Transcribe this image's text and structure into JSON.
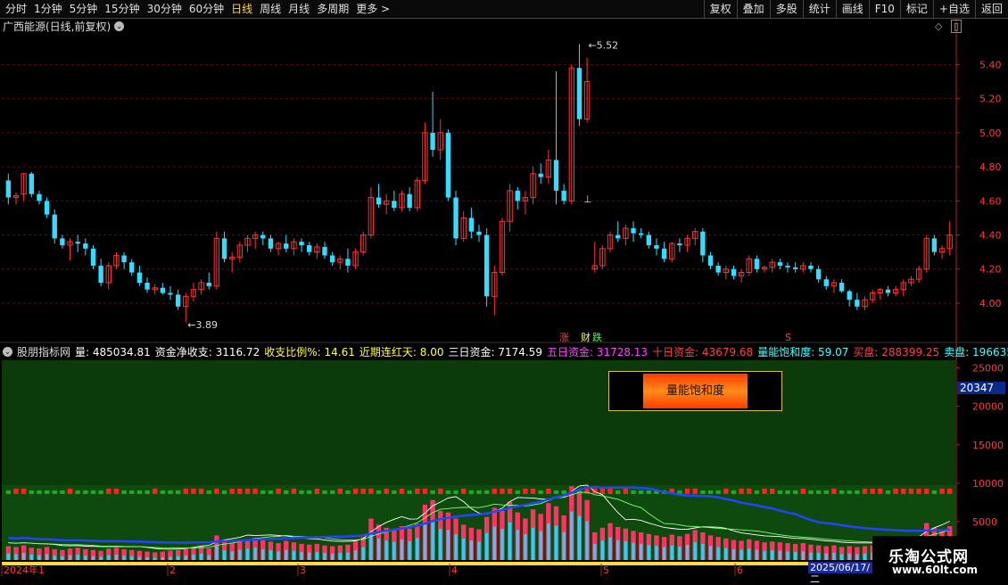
{
  "toolbar": {
    "periods": [
      "分时",
      "1分钟",
      "5分钟",
      "15分钟",
      "30分钟",
      "60分钟",
      "日线",
      "周线",
      "月线",
      "多周期",
      "更多 >"
    ],
    "active_index": 6,
    "right": [
      "复权",
      "叠加",
      "多股",
      "统计",
      "画线",
      "F10",
      "标记",
      "+自选",
      "返回"
    ]
  },
  "main": {
    "title": "广西能源(日线,前复权)",
    "high_label": "5.52",
    "low_label": "3.89",
    "price_ticks": [
      "5.40",
      "5.20",
      "5.00",
      "4.80",
      "4.60",
      "4.40",
      "4.20",
      "4.00"
    ],
    "price_range": [
      3.78,
      5.58
    ],
    "marker_zhang": "涨",
    "marker_cai": "财",
    "marker_die": "跌",
    "marker_s": "S",
    "marker_down": "⊥"
  },
  "indicator": {
    "name": "股朋指标网",
    "fields": [
      {
        "label": "量:",
        "value": "485034.81",
        "color": "#ffffff"
      },
      {
        "label": "资金净收支:",
        "value": "3116.72",
        "color": "#ffffff"
      },
      {
        "label": "收支比例%:",
        "value": "14.61",
        "color": "#ffff44"
      },
      {
        "label": "近期连红天:",
        "value": "8.00",
        "color": "#ffff44"
      },
      {
        "label": "三日资金:",
        "value": "7174.59",
        "color": "#ffffff"
      },
      {
        "label": "五日资金:",
        "value": "31728.13",
        "color": "#ff44ff"
      },
      {
        "label": "十日资金:",
        "value": "43679.68",
        "color": "#ff4040"
      },
      {
        "label": "量能饱和度:",
        "value": "59.07",
        "color": "#44ffff"
      },
      {
        "label": "买盘:",
        "value": "288399.25",
        "color": "#ff4040"
      },
      {
        "label": "卖盘:",
        "value": "196635.",
        "color": "#44ffff"
      }
    ],
    "box_label": "量能饱和度",
    "tag_value": "20347",
    "y_ticks": [
      "25000",
      "20000",
      "15000",
      "10000",
      "5000"
    ],
    "y_range": [
      0,
      26000
    ]
  },
  "x_axis": {
    "labels": [
      "2024年1",
      "2",
      "3",
      "4",
      "5",
      "6"
    ],
    "date_box": "2025/06/17/二"
  },
  "watermark": {
    "title": "乐淘公式网",
    "url": "www.60lt.com"
  },
  "colors": {
    "up": "#ff3333",
    "down": "#33ddff",
    "axis": "#aa2222"
  },
  "chart_data": {
    "type": "candlestick",
    "ohlc": [
      [
        4.72,
        4.76,
        4.58,
        4.62
      ],
      [
        4.62,
        4.65,
        4.58,
        4.63
      ],
      [
        4.64,
        4.76,
        4.6,
        4.76
      ],
      [
        4.76,
        4.77,
        4.62,
        4.64
      ],
      [
        4.64,
        4.66,
        4.58,
        4.6
      ],
      [
        4.6,
        4.62,
        4.5,
        4.52
      ],
      [
        4.52,
        4.55,
        4.35,
        4.38
      ],
      [
        4.38,
        4.4,
        4.32,
        4.34
      ],
      [
        4.34,
        4.38,
        4.25,
        4.36
      ],
      [
        4.36,
        4.4,
        4.3,
        4.35
      ],
      [
        4.35,
        4.38,
        4.28,
        4.32
      ],
      [
        4.32,
        4.34,
        4.2,
        4.22
      ],
      [
        4.22,
        4.26,
        4.1,
        4.12
      ],
      [
        4.12,
        4.24,
        4.08,
        4.22
      ],
      [
        4.22,
        4.3,
        4.2,
        4.28
      ],
      [
        4.28,
        4.3,
        4.2,
        4.24
      ],
      [
        4.24,
        4.26,
        4.16,
        4.18
      ],
      [
        4.18,
        4.22,
        4.1,
        4.12
      ],
      [
        4.12,
        4.15,
        4.06,
        4.08
      ],
      [
        4.08,
        4.11,
        4.05,
        4.09
      ],
      [
        4.09,
        4.12,
        4.05,
        4.06
      ],
      [
        4.06,
        4.1,
        4.02,
        4.05
      ],
      [
        4.05,
        4.08,
        3.96,
        3.98
      ],
      [
        3.98,
        4.06,
        3.89,
        4.04
      ],
      [
        4.04,
        4.12,
        4.01,
        4.08
      ],
      [
        4.08,
        4.14,
        4.05,
        4.12
      ],
      [
        4.12,
        4.18,
        4.08,
        4.1
      ],
      [
        4.1,
        4.42,
        4.08,
        4.38
      ],
      [
        4.38,
        4.42,
        4.24,
        4.26
      ],
      [
        4.26,
        4.3,
        4.18,
        4.27
      ],
      [
        4.27,
        4.36,
        4.24,
        4.34
      ],
      [
        4.34,
        4.4,
        4.3,
        4.38
      ],
      [
        4.38,
        4.42,
        4.32,
        4.4
      ],
      [
        4.4,
        4.42,
        4.34,
        4.38
      ],
      [
        4.38,
        4.4,
        4.3,
        4.32
      ],
      [
        4.32,
        4.36,
        4.28,
        4.35
      ],
      [
        4.35,
        4.4,
        4.3,
        4.32
      ],
      [
        4.32,
        4.38,
        4.28,
        4.36
      ],
      [
        4.36,
        4.38,
        4.3,
        4.34
      ],
      [
        4.34,
        4.36,
        4.28,
        4.3
      ],
      [
        4.3,
        4.35,
        4.26,
        4.33
      ],
      [
        4.33,
        4.36,
        4.26,
        4.28
      ],
      [
        4.28,
        4.3,
        4.22,
        4.24
      ],
      [
        4.24,
        4.28,
        4.2,
        4.26
      ],
      [
        4.26,
        4.32,
        4.18,
        4.22
      ],
      [
        4.22,
        4.32,
        4.2,
        4.3
      ],
      [
        4.3,
        4.42,
        4.28,
        4.4
      ],
      [
        4.4,
        4.68,
        4.38,
        4.62
      ],
      [
        4.62,
        4.7,
        4.56,
        4.58
      ],
      [
        4.58,
        4.64,
        4.52,
        4.6
      ],
      [
        4.6,
        4.66,
        4.54,
        4.56
      ],
      [
        4.56,
        4.66,
        4.54,
        4.64
      ],
      [
        4.64,
        4.68,
        4.54,
        4.56
      ],
      [
        4.56,
        4.74,
        4.54,
        4.72
      ],
      [
        4.72,
        5.06,
        4.7,
        5.0
      ],
      [
        5.0,
        5.24,
        4.86,
        4.9
      ],
      [
        4.9,
        5.08,
        4.84,
        5.0
      ],
      [
        5.0,
        5.02,
        4.6,
        4.62
      ],
      [
        4.62,
        4.66,
        4.34,
        4.38
      ],
      [
        4.38,
        4.54,
        4.36,
        4.5
      ],
      [
        4.5,
        4.56,
        4.38,
        4.42
      ],
      [
        4.42,
        4.46,
        4.36,
        4.4
      ],
      [
        4.4,
        4.44,
        3.98,
        4.04
      ],
      [
        4.04,
        4.22,
        3.93,
        4.18
      ],
      [
        4.18,
        4.5,
        4.16,
        4.48
      ],
      [
        4.48,
        4.7,
        4.42,
        4.66
      ],
      [
        4.66,
        4.68,
        4.55,
        4.6
      ],
      [
        4.6,
        4.66,
        4.52,
        4.62
      ],
      [
        4.62,
        4.8,
        4.58,
        4.76
      ],
      [
        4.76,
        4.82,
        4.7,
        4.74
      ],
      [
        4.74,
        4.9,
        4.7,
        4.84
      ],
      [
        4.84,
        5.36,
        4.58,
        4.66
      ],
      [
        4.66,
        4.7,
        4.58,
        4.6
      ],
      [
        4.6,
        5.4,
        4.58,
        5.38
      ],
      [
        5.38,
        5.52,
        5.04,
        5.08
      ],
      [
        5.08,
        5.44,
        5.06,
        5.3
      ],
      [
        4.2,
        4.36,
        4.18,
        4.22
      ],
      [
        4.22,
        4.34,
        4.2,
        4.32
      ],
      [
        4.32,
        4.42,
        4.3,
        4.4
      ],
      [
        4.4,
        4.48,
        4.36,
        4.38
      ],
      [
        4.38,
        4.46,
        4.34,
        4.44
      ],
      [
        4.44,
        4.48,
        4.36,
        4.41
      ],
      [
        4.41,
        4.44,
        4.38,
        4.4
      ],
      [
        4.4,
        4.42,
        4.32,
        4.34
      ],
      [
        4.34,
        4.38,
        4.28,
        4.32
      ],
      [
        4.32,
        4.36,
        4.24,
        4.26
      ],
      [
        4.26,
        4.36,
        4.24,
        4.35
      ],
      [
        4.35,
        4.38,
        4.3,
        4.34
      ],
      [
        4.34,
        4.4,
        4.3,
        4.38
      ],
      [
        4.38,
        4.44,
        4.34,
        4.42
      ],
      [
        4.42,
        4.44,
        4.24,
        4.28
      ],
      [
        4.28,
        4.3,
        4.2,
        4.22
      ],
      [
        4.22,
        4.24,
        4.16,
        4.18
      ],
      [
        4.18,
        4.22,
        4.14,
        4.2
      ],
      [
        4.2,
        4.22,
        4.14,
        4.16
      ],
      [
        4.16,
        4.2,
        4.12,
        4.18
      ],
      [
        4.18,
        4.28,
        4.16,
        4.26
      ],
      [
        4.26,
        4.28,
        4.18,
        4.2
      ],
      [
        4.2,
        4.22,
        4.18,
        4.21
      ],
      [
        4.21,
        4.26,
        4.18,
        4.24
      ],
      [
        4.24,
        4.26,
        4.2,
        4.22
      ],
      [
        4.22,
        4.24,
        4.18,
        4.21
      ],
      [
        4.21,
        4.24,
        4.18,
        4.2
      ],
      [
        4.2,
        4.24,
        4.18,
        4.22
      ],
      [
        4.22,
        4.24,
        4.18,
        4.2
      ],
      [
        4.2,
        4.22,
        4.12,
        4.14
      ],
      [
        4.14,
        4.16,
        4.08,
        4.1
      ],
      [
        4.1,
        4.14,
        4.06,
        4.12
      ],
      [
        4.12,
        4.14,
        4.06,
        4.07
      ],
      [
        4.07,
        4.08,
        3.98,
        4.02
      ],
      [
        4.02,
        4.06,
        3.96,
        3.98
      ],
      [
        3.98,
        4.04,
        3.96,
        4.02
      ],
      [
        4.02,
        4.08,
        4.0,
        4.06
      ],
      [
        4.06,
        4.09,
        4.02,
        4.08
      ],
      [
        4.08,
        4.1,
        4.04,
        4.06
      ],
      [
        4.06,
        4.1,
        4.04,
        4.08
      ],
      [
        4.08,
        4.14,
        4.04,
        4.12
      ],
      [
        4.12,
        4.16,
        4.1,
        4.14
      ],
      [
        4.14,
        4.22,
        4.12,
        4.2
      ],
      [
        4.2,
        4.4,
        4.18,
        4.38
      ],
      [
        4.38,
        4.4,
        4.28,
        4.3
      ],
      [
        4.3,
        4.34,
        4.26,
        4.32
      ],
      [
        4.32,
        4.48,
        4.28,
        4.4
      ]
    ],
    "volume": [
      1800,
      1700,
      1900,
      1600,
      1500,
      1700,
      1400,
      1300,
      1500,
      1600,
      1400,
      1300,
      1200,
      1500,
      1600,
      1400,
      1300,
      1200,
      1100,
      1000,
      1100,
      1200,
      1300,
      1400,
      1600,
      1800,
      1500,
      3200,
      2400,
      2200,
      2500,
      2700,
      2900,
      2600,
      2400,
      2200,
      2500,
      2300,
      2100,
      2000,
      2100,
      1900,
      1800,
      1900,
      2000,
      2400,
      3000,
      5400,
      4600,
      4200,
      4000,
      4400,
      4100,
      4700,
      7200,
      7800,
      6400,
      6200,
      5400,
      4600,
      4200,
      4000,
      5600,
      6800,
      6400,
      7600,
      6200,
      5400,
      6600,
      6000,
      7400,
      7000,
      5800,
      9600,
      8800,
      7800,
      3600,
      4200,
      4800,
      4300,
      4100,
      3800,
      3600,
      3400,
      3200,
      3000,
      3300,
      3100,
      3400,
      3900,
      3600,
      3200,
      3000,
      2800,
      2600,
      2500,
      2700,
      2500,
      2300,
      2400,
      2300,
      2200,
      2100,
      2200,
      2000,
      1900,
      1800,
      1900,
      1700,
      1800,
      1700,
      1800,
      1900,
      2000,
      2100,
      2200,
      2300,
      2500,
      3000,
      4800,
      4200,
      3800,
      4400
    ],
    "inflow": [
      1200,
      1100,
      1300,
      1000,
      900,
      1100,
      800,
      700,
      900,
      1000,
      800,
      700,
      600,
      900,
      1000,
      800,
      700,
      600,
      500,
      400,
      500,
      600,
      700,
      800,
      1000,
      1200,
      900,
      2600,
      1800,
      1600,
      1900,
      2100,
      2300,
      2000,
      1800,
      1600,
      1900,
      1700,
      1500,
      1400,
      1500,
      1300,
      1200,
      1300,
      1400,
      1800,
      2400,
      4800,
      4000,
      3600,
      3400,
      3800,
      3500,
      4100,
      6600,
      7200,
      5800,
      5600,
      4800,
      4000,
      3600,
      3400,
      5000,
      6200,
      5800,
      7000,
      5600,
      4800,
      6000,
      5400,
      6800,
      6400,
      5200,
      9000,
      8200,
      7200,
      3000,
      3600,
      4200,
      3700,
      3500,
      3200,
      3000,
      2800,
      2600,
      2400,
      2700,
      2500,
      2800,
      3300,
      3000,
      2600,
      2400,
      2200,
      2000,
      1900,
      2100,
      1900,
      1700,
      1800,
      1700,
      1600,
      1500,
      1600,
      1400,
      1300,
      1200,
      1300,
      1100,
      1200,
      1100,
      1200,
      1300,
      1400,
      1500,
      1600,
      1700,
      1900,
      2400,
      4200,
      3600,
      3200,
      3800
    ]
  }
}
